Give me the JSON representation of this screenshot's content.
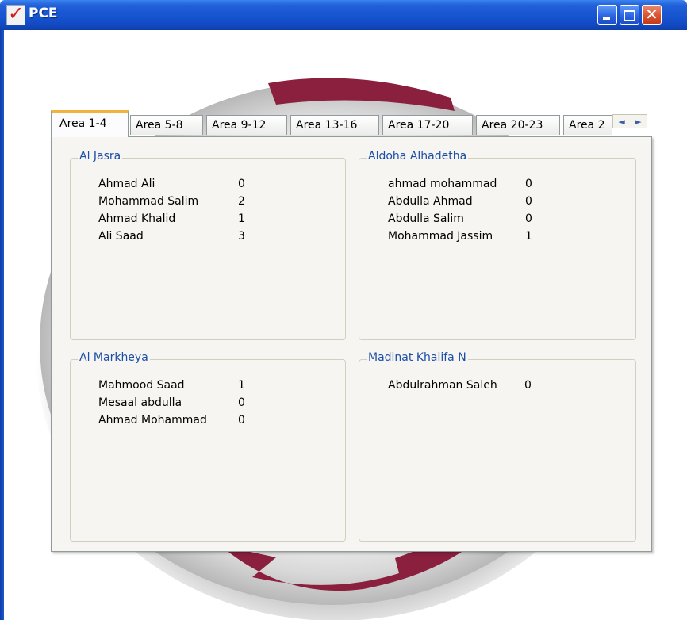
{
  "window": {
    "title": "PCE"
  },
  "icons": {
    "app": "red-checkmark-icon",
    "minimize": "minimize-icon",
    "maximize": "maximize-icon",
    "close": "close-icon"
  },
  "tabs": [
    {
      "label": "Area 1-4",
      "active": true
    },
    {
      "label": "Area 5-8"
    },
    {
      "label": "Area 9-12"
    },
    {
      "label": "Area 13-16"
    },
    {
      "label": "Area 17-20"
    },
    {
      "label": "Area 20-23"
    },
    {
      "label": "Area 2"
    }
  ],
  "tab_scroll": {
    "left": "◄",
    "right": "►"
  },
  "groups": [
    {
      "title": "Al Jasra",
      "rows": [
        {
          "name": "Ahmad Ali",
          "count": "0"
        },
        {
          "name": "Mohammad Salim",
          "count": "2"
        },
        {
          "name": "Ahmad Khalid",
          "count": "1"
        },
        {
          "name": "Ali Saad",
          "count": "3"
        }
      ]
    },
    {
      "title": "Aldoha Alhadetha",
      "rows": [
        {
          "name": "ahmad mohammad",
          "count": "0"
        },
        {
          "name": "Abdulla Ahmad",
          "count": "0"
        },
        {
          "name": "Abdulla Salim",
          "count": "0"
        },
        {
          "name": "Mohammad Jassim",
          "count": "1"
        }
      ]
    },
    {
      "title": "Al Markheya",
      "rows": [
        {
          "name": "Mahmood Saad",
          "count": "1"
        },
        {
          "name": "Mesaal abdulla",
          "count": "0"
        },
        {
          "name": "Ahmad Mohammad",
          "count": "0"
        }
      ]
    },
    {
      "title": "Madinat Khalifa N",
      "rows": [
        {
          "name": "Abdulrahman Saleh",
          "count": "0"
        }
      ]
    }
  ]
}
